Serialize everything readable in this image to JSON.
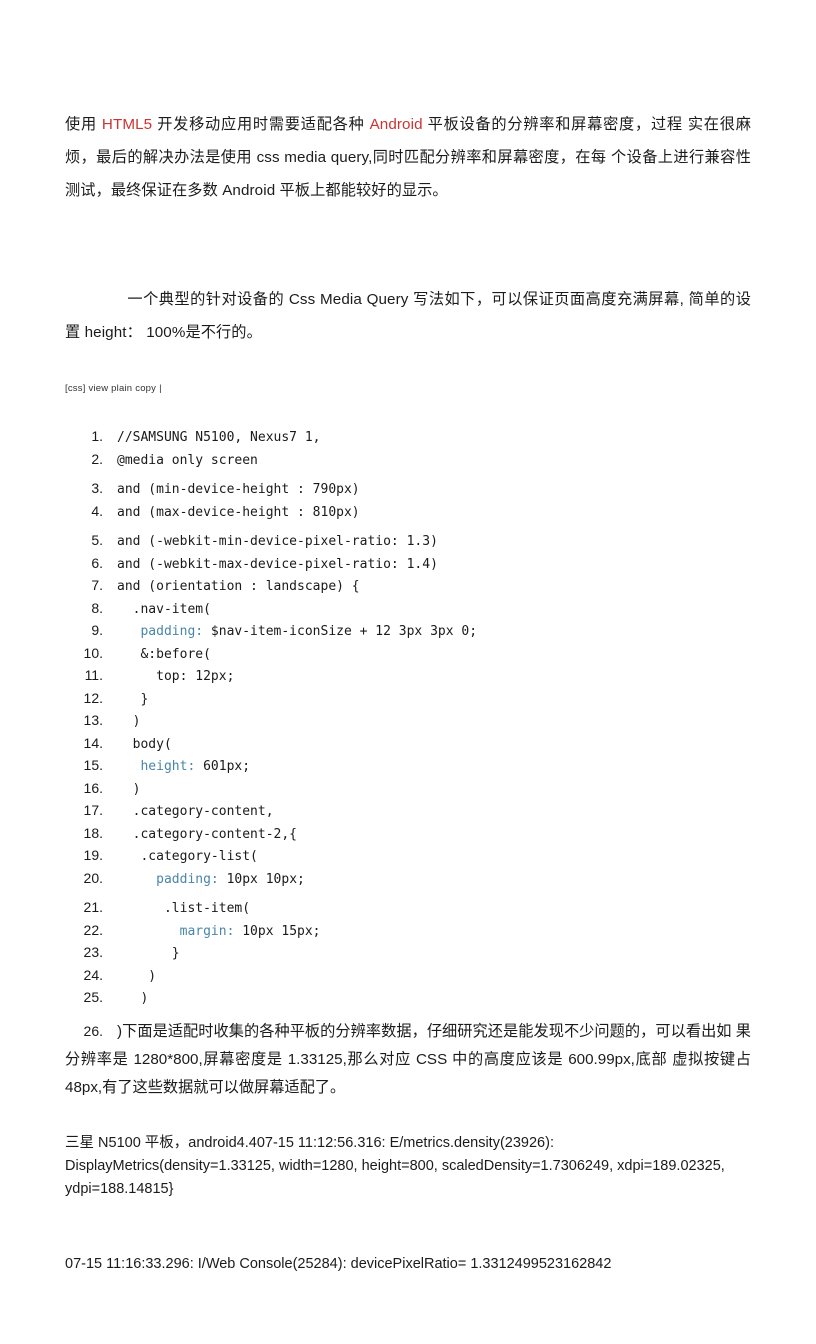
{
  "document": {
    "intro_paragraph": {
      "segments": [
        {
          "text": "使用 ",
          "style": "normal"
        },
        {
          "text": "HTML5",
          "style": "highlight"
        },
        {
          "text": " 开发移动应用时需要适配各种 ",
          "style": "normal"
        },
        {
          "text": "Android",
          "style": "highlight"
        },
        {
          "text": " 平板设备的分辨率和屏幕密度，过程 实在很麻烦，最后的解决办法是使用 css media query,同时匹配分辨率和屏幕密度，在每 个设备上进行兼容性测试，最终保证在多数 Android 平板上都能较好的显示。",
          "style": "normal"
        }
      ]
    },
    "second_paragraph": {
      "text": "一个典型的针对设备的 Css Media Query 写法如下，可以保证页面高度充满屏幕, 简单的设置 height： 100%是不行的。"
    },
    "code_toolbar": {
      "language_tag": "[css]",
      "view_plain": "view plain",
      "copy": "copy",
      "separator": "|"
    },
    "code_listing": {
      "lines": [
        {
          "number": "1.",
          "spaced": false,
          "parts": [
            {
              "t": "//SAMSUNG N5100, Nexus7 1,",
              "k": false
            }
          ]
        },
        {
          "number": "2.",
          "spaced": false,
          "parts": [
            {
              "t": "@media only screen",
              "k": false
            }
          ]
        },
        {
          "number": "3.",
          "spaced": true,
          "parts": [
            {
              "t": "and (min-device-height : 790px)",
              "k": false
            }
          ]
        },
        {
          "number": "4.",
          "spaced": false,
          "parts": [
            {
              "t": "and (max-device-height : 810px)",
              "k": false
            }
          ]
        },
        {
          "number": "5.",
          "spaced": true,
          "parts": [
            {
              "t": "and (-webkit-min-device-pixel-ratio: 1.3)",
              "k": false
            }
          ]
        },
        {
          "number": "6.",
          "spaced": false,
          "parts": [
            {
              "t": "and (-webkit-max-device-pixel-ratio: 1.4)",
              "k": false
            }
          ]
        },
        {
          "number": "7.",
          "spaced": false,
          "parts": [
            {
              "t": "and (orientation : landscape) {",
              "k": false
            }
          ]
        },
        {
          "number": "8.",
          "spaced": false,
          "parts": [
            {
              "t": "  .nav-item(",
              "k": false
            }
          ]
        },
        {
          "number": "9.",
          "spaced": false,
          "parts": [
            {
              "t": "   padding:",
              "k": true
            },
            {
              "t": " $nav-item-iconSize + 12 3px 3px 0;",
              "k": false
            }
          ]
        },
        {
          "number": "10.",
          "spaced": false,
          "parts": [
            {
              "t": "   &:before(",
              "k": false
            }
          ]
        },
        {
          "number": "11.",
          "spaced": false,
          "parts": [
            {
              "t": "     top: 12px;",
              "k": false
            }
          ]
        },
        {
          "number": "12.",
          "spaced": false,
          "parts": [
            {
              "t": "   }",
              "k": false
            }
          ]
        },
        {
          "number": "13.",
          "spaced": false,
          "parts": [
            {
              "t": "  )",
              "k": false
            }
          ]
        },
        {
          "number": "14.",
          "spaced": false,
          "parts": [
            {
              "t": "  body(",
              "k": false
            }
          ]
        },
        {
          "number": "15.",
          "spaced": false,
          "parts": [
            {
              "t": "   height:",
              "k": true
            },
            {
              "t": " 601px;",
              "k": false
            }
          ]
        },
        {
          "number": "16.",
          "spaced": false,
          "parts": [
            {
              "t": "  )",
              "k": false
            }
          ]
        },
        {
          "number": "17.",
          "spaced": false,
          "parts": [
            {
              "t": "  .category-content,",
              "k": false
            }
          ]
        },
        {
          "number": "18.",
          "spaced": false,
          "parts": [
            {
              "t": "  .category-content-2,{",
              "k": false
            }
          ]
        },
        {
          "number": "19.",
          "spaced": false,
          "parts": [
            {
              "t": "   .category-list(",
              "k": false
            }
          ]
        },
        {
          "number": "20.",
          "spaced": false,
          "parts": [
            {
              "t": "     padding:",
              "k": true
            },
            {
              "t": " 10px 10px;",
              "k": false
            }
          ]
        },
        {
          "number": "21.",
          "spaced": true,
          "parts": [
            {
              "t": "      .list-item(",
              "k": false
            }
          ]
        },
        {
          "number": "22.",
          "spaced": false,
          "parts": [
            {
              "t": "        margin:",
              "k": true
            },
            {
              "t": " 10px 15px;",
              "k": false
            }
          ]
        },
        {
          "number": "23.",
          "spaced": false,
          "parts": [
            {
              "t": "       }",
              "k": false
            }
          ]
        },
        {
          "number": "24.",
          "spaced": false,
          "parts": [
            {
              "t": "    )",
              "k": false
            }
          ]
        },
        {
          "number": "25.",
          "spaced": false,
          "parts": [
            {
              "t": "   )",
              "k": false
            }
          ]
        }
      ],
      "final_line": {
        "number": "26.",
        "text": ")下面是适配时收集的各种平板的分辨率数据，仔细研究还是能发现不少问题的，可以看出如 果分辨率是 1280*800,屏幕密度是 1.33125,那么对应 CSS 中的高度应该是 600.99px,底部 虚拟按键占 48px,有了这些数据就可以做屏幕适配了。"
      }
    },
    "logs": {
      "display_metrics": "三星 N5100 平板，android4.407-15 11:12:56.316: E/metrics.density(23926): DisplayMetrics(density=1.33125, width=1280, height=800, scaledDensity=1.7306249, xdpi=189.02325, ydpi=188.14815}",
      "web_console": "07-15 11:16:33.296: I/Web Console(25284): devicePixelRatio= 1.3312499523162842"
    },
    "colors": {
      "highlight_red": "#cc3333",
      "code_keyword_blue": "#4a86a8",
      "body_text": "#1b1b1b",
      "page_background": "#ffffff"
    }
  }
}
